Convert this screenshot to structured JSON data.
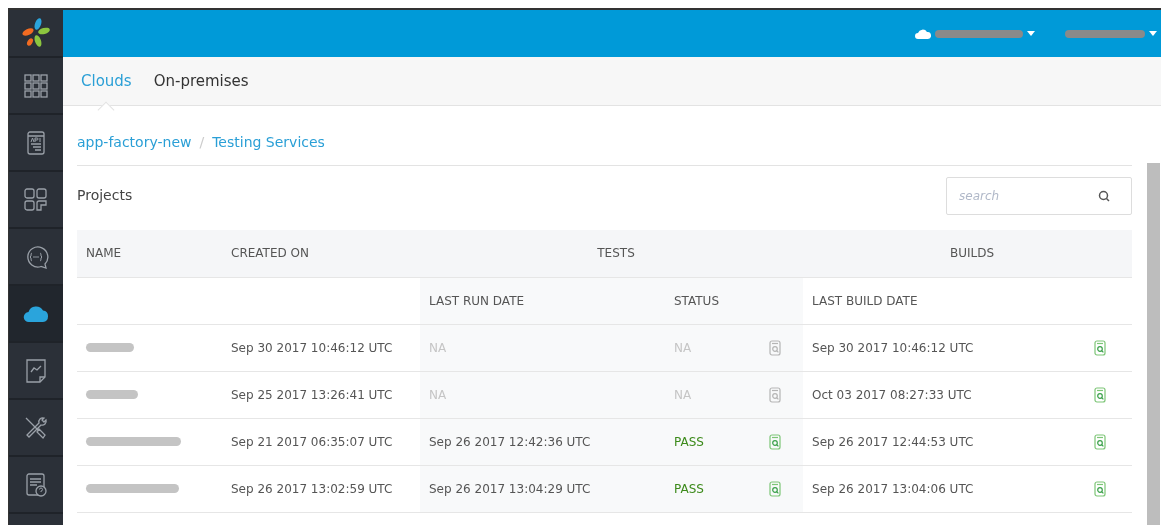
{
  "sidebar": {
    "items": [
      {
        "kind": "grid",
        "selected": false
      },
      {
        "kind": "api",
        "selected": false
      },
      {
        "kind": "tiles",
        "selected": false
      },
      {
        "kind": "chat",
        "selected": false
      },
      {
        "kind": "cloud",
        "selected": true
      },
      {
        "kind": "chart",
        "selected": false
      },
      {
        "kind": "tools",
        "selected": false
      },
      {
        "kind": "help",
        "selected": false
      }
    ]
  },
  "tabs": [
    {
      "label": "Clouds",
      "selected": true
    },
    {
      "label": "On-premises",
      "selected": false
    }
  ],
  "breadcrumb": [
    "app-factory-new",
    "Testing Services"
  ],
  "breadcrumb_separator": "/",
  "section_title": "Projects",
  "search": {
    "placeholder": "search"
  },
  "table": {
    "columns": [
      "NAME",
      "CREATED ON",
      "TESTS",
      "BUILDS"
    ],
    "sub_columns": [
      "LAST RUN DATE",
      "STATUS",
      "LAST BUILD DATE"
    ],
    "rows": [
      {
        "created_on": "Sep 30 2017 10:46:12 UTC",
        "last_run_date": "NA",
        "status": "NA",
        "test_report": false,
        "last_build_date": "Sep 30 2017 10:46:12 UTC",
        "build_report": true
      },
      {
        "created_on": "Sep 25 2017 13:26:41 UTC",
        "last_run_date": "NA",
        "status": "NA",
        "test_report": false,
        "last_build_date": "Oct 03 2017 08:27:33 UTC",
        "build_report": true
      },
      {
        "created_on": "Sep 21 2017 06:35:07 UTC",
        "last_run_date": "Sep 26 2017 12:42:36 UTC",
        "status": "PASS",
        "test_report": true,
        "last_build_date": "Sep 26 2017 12:44:53 UTC",
        "build_report": true
      },
      {
        "created_on": "Sep 26 2017 13:02:59 UTC",
        "last_run_date": "Sep 26 2017 13:04:29 UTC",
        "status": "PASS",
        "test_report": true,
        "last_build_date": "Sep 26 2017 13:04:06 UTC",
        "build_report": true
      }
    ]
  }
}
